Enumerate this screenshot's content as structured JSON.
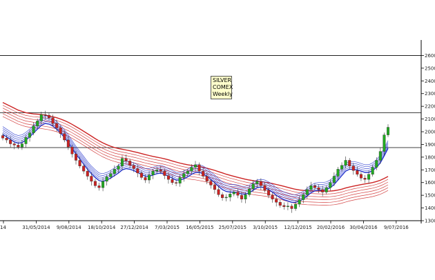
{
  "chart_data": {
    "type": "candlestick",
    "annotation_lines": [
      "SILVER",
      "COMEX",
      "Weekly"
    ],
    "x_ticks": [
      "14",
      "31/05/2014",
      "9/08/2014",
      "18/10/2014",
      "27/12/2014",
      "7/03/2015",
      "16/05/2015",
      "25/07/2015",
      "3/10/2015",
      "12/12/2015",
      "20/02/2016",
      "30/04/2016",
      "9/07/2016"
    ],
    "y_ticks": [
      1300,
      1400,
      1500,
      1600,
      1700,
      1800,
      1900,
      2000,
      2100,
      2200,
      2300,
      2400,
      2500,
      2600
    ],
    "ylim": [
      1300,
      2700
    ],
    "horizontal_lines": [
      2600,
      2150,
      1875
    ],
    "colors": {
      "up": "#22aa22",
      "down": "#cc2222",
      "short_ma": "#2233cc",
      "long_ma": "#cc2222"
    },
    "series_candles": {
      "weeks_start": "2014-04",
      "close": [
        1950,
        1935,
        1905,
        1895,
        1880,
        1905,
        1955,
        1990,
        2045,
        2085,
        2135,
        2130,
        2110,
        2065,
        2030,
        1985,
        1935,
        1880,
        1825,
        1775,
        1730,
        1690,
        1650,
        1610,
        1575,
        1560,
        1610,
        1645,
        1670,
        1705,
        1730,
        1790,
        1770,
        1735,
        1710,
        1675,
        1640,
        1620,
        1660,
        1690,
        1700,
        1690,
        1655,
        1625,
        1600,
        1595,
        1640,
        1670,
        1690,
        1720,
        1740,
        1690,
        1650,
        1610,
        1580,
        1545,
        1505,
        1480,
        1485,
        1510,
        1525,
        1500,
        1470,
        1505,
        1550,
        1590,
        1610,
        1575,
        1540,
        1500,
        1470,
        1445,
        1420,
        1410,
        1415,
        1395,
        1430,
        1465,
        1505,
        1545,
        1575,
        1560,
        1545,
        1525,
        1560,
        1600,
        1650,
        1705,
        1735,
        1775,
        1730,
        1695,
        1665,
        1635,
        1625,
        1665,
        1720,
        1775,
        1845,
        1975,
        2035
      ]
    },
    "series_ma_short": [
      1980,
      1960,
      1940,
      1920,
      1910,
      1915,
      1935,
      1960,
      1990,
      2020,
      2050,
      2065,
      2060,
      2045,
      2020,
      1990,
      1955,
      1915,
      1870,
      1825,
      1785,
      1745,
      1705,
      1670,
      1640,
      1615,
      1610,
      1620,
      1635,
      1655,
      1675,
      1700,
      1710,
      1705,
      1695,
      1680,
      1665,
      1650,
      1650,
      1660,
      1670,
      1675,
      1665,
      1650,
      1635,
      1620,
      1620,
      1630,
      1645,
      1665,
      1680,
      1680,
      1670,
      1650,
      1625,
      1600,
      1570,
      1545,
      1530,
      1525,
      1525,
      1520,
      1510,
      1510,
      1520,
      1540,
      1560,
      1565,
      1560,
      1545,
      1525,
      1500,
      1480,
      1465,
      1455,
      1445,
      1445,
      1455,
      1470,
      1495,
      1520,
      1535,
      1540,
      1540,
      1545,
      1560,
      1585,
      1620,
      1655,
      1690,
      1705,
      1705,
      1700,
      1690,
      1680,
      1680,
      1695,
      1720,
      1755,
      1810,
      1870
    ],
    "series_ma_long": [
      2230,
      2215,
      2200,
      2185,
      2170,
      2160,
      2150,
      2145,
      2140,
      2138,
      2135,
      2130,
      2125,
      2118,
      2110,
      2100,
      2088,
      2074,
      2058,
      2040,
      2022,
      2003,
      1984,
      1965,
      1946,
      1928,
      1912,
      1898,
      1886,
      1876,
      1868,
      1862,
      1856,
      1850,
      1843,
      1836,
      1828,
      1820,
      1813,
      1806,
      1800,
      1794,
      1787,
      1779,
      1770,
      1761,
      1753,
      1746,
      1740,
      1735,
      1731,
      1726,
      1720,
      1713,
      1705,
      1696,
      1686,
      1676,
      1666,
      1657,
      1649,
      1641,
      1633,
      1626,
      1620,
      1615,
      1611,
      1607,
      1603,
      1598,
      1592,
      1585,
      1578,
      1570,
      1562,
      1554,
      1547,
      1542,
      1538,
      1536,
      1535,
      1534,
      1533,
      1532,
      1532,
      1533,
      1536,
      1541,
      1548,
      1557,
      1565,
      1572,
      1578,
      1584,
      1589,
      1594,
      1600,
      1608,
      1618,
      1632,
      1648
    ]
  }
}
